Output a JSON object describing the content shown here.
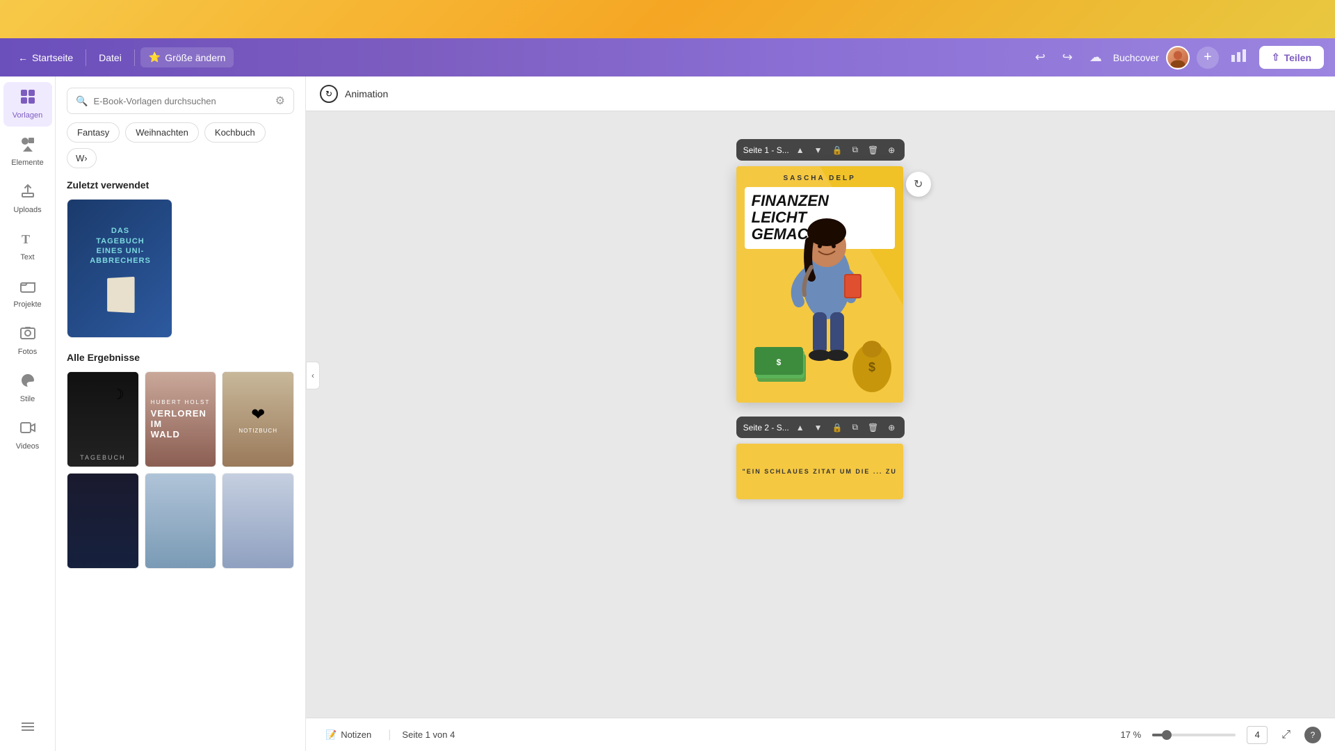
{
  "topBar": {},
  "header": {
    "backLabel": "Startseite",
    "fileLabel": "Datei",
    "sizeChangeLabel": "Größe ändern",
    "sizeIcon": "🌟",
    "buchcoverLabel": "Buchcover",
    "shareLabel": "Teilen",
    "undoTitle": "Undo",
    "redoTitle": "Redo",
    "cloudTitle": "Save to cloud"
  },
  "sidebar": {
    "items": [
      {
        "id": "vorlagen",
        "label": "Vorlagen",
        "icon": "grid"
      },
      {
        "id": "elemente",
        "label": "Elemente",
        "icon": "shapes"
      },
      {
        "id": "uploads",
        "label": "Uploads",
        "icon": "upload"
      },
      {
        "id": "text",
        "label": "Text",
        "icon": "text"
      },
      {
        "id": "projekte",
        "label": "Projekte",
        "icon": "folder"
      },
      {
        "id": "fotos",
        "label": "Fotos",
        "icon": "image"
      },
      {
        "id": "stile",
        "label": "Stile",
        "icon": "palette"
      },
      {
        "id": "videos",
        "label": "Videos",
        "icon": "video"
      }
    ]
  },
  "templatesPanel": {
    "searchPlaceholder": "E-Book-Vorlagen durchsuchen",
    "filterChips": [
      "Fantasy",
      "Weihnachten",
      "Kochbuch",
      "W..."
    ],
    "recentlyUsedLabel": "Zuletzt verwendet",
    "allResultsLabel": "Alle Ergebnisse",
    "recentThumb": {
      "title": "DAS TAGEBUCH EINES UNI-ABBRECHERS"
    }
  },
  "animationBar": {
    "label": "Animation"
  },
  "canvas": {
    "page1Label": "Seite 1 - S...",
    "page2Label": "Seite 2 - S...",
    "coverAuthor": "SASCHA DELP",
    "coverTitle": "FINANZEN\nLEICHT\nGEMACHT!",
    "page2Quote": "\"EIN SCHLAUES ZITAT UM DIE ... ZU"
  },
  "statusBar": {
    "notesLabel": "Notizen",
    "pageIndicator": "Seite 1 von 4",
    "zoomLevel": "17 %",
    "zoomPercent": 17,
    "pageCount": "4",
    "fullscreenTitle": "Fullscreen",
    "helpTitle": "Help",
    "helpLabel": "?"
  }
}
